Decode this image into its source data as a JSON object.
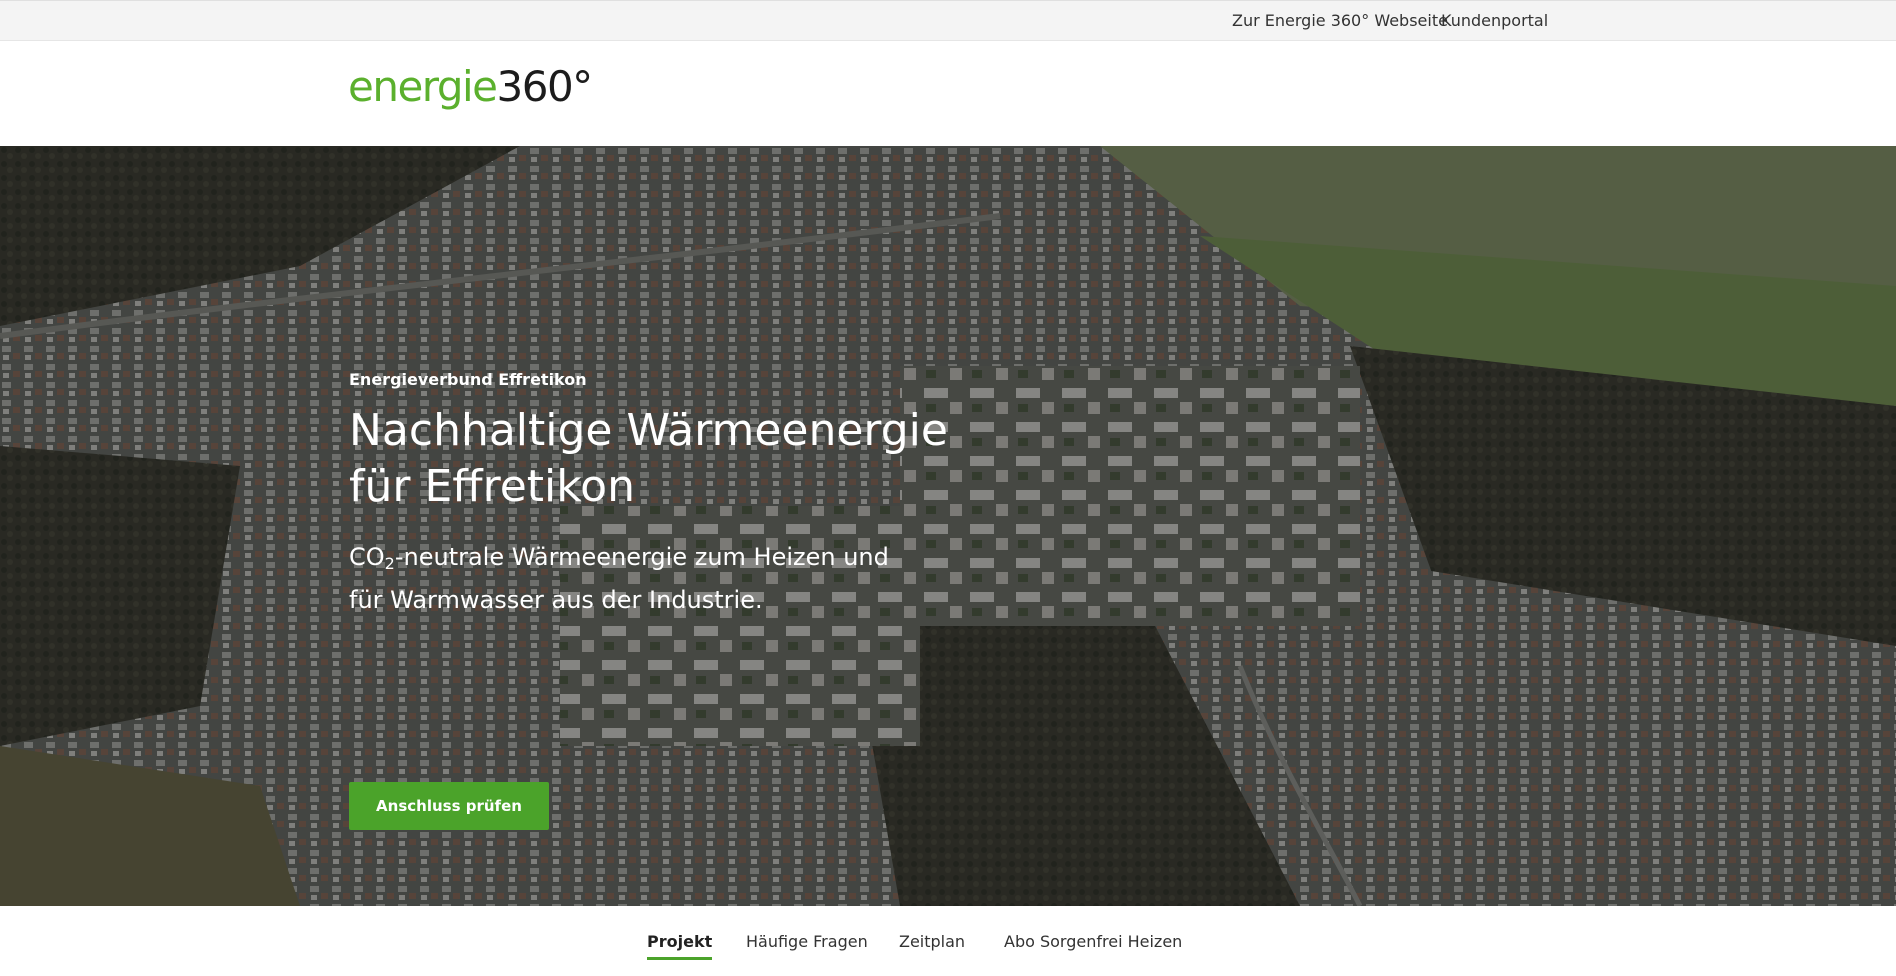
{
  "topbar": {
    "website_link": "Zur Energie 360° Webseite",
    "portal_link": "Kundenportal"
  },
  "logo": {
    "brand_green": "energie",
    "brand_dark": "360°"
  },
  "hero": {
    "eyebrow": "Energieverbund Effretikon",
    "headline": "Nachhaltige Wärmeenergie für Effretikon",
    "sub_prefix": "CO",
    "sub_subscript": "2",
    "sub_rest": "-neutrale Wärmeenergie zum Heizen und für Warmwasser aus der Industrie.",
    "cta_label": "Anschluss prüfen"
  },
  "subnav": {
    "tabs": [
      {
        "label": "Projekt",
        "active": true
      },
      {
        "label": "Häufige Fragen",
        "active": false
      },
      {
        "label": "Zeitplan",
        "active": false
      },
      {
        "label": "Abo Sorgenfrei Heizen",
        "active": false
      }
    ]
  },
  "colors": {
    "accent_green": "#4ba32a",
    "logo_green": "#5bb02d",
    "topbar_bg": "#f4f4f4"
  }
}
